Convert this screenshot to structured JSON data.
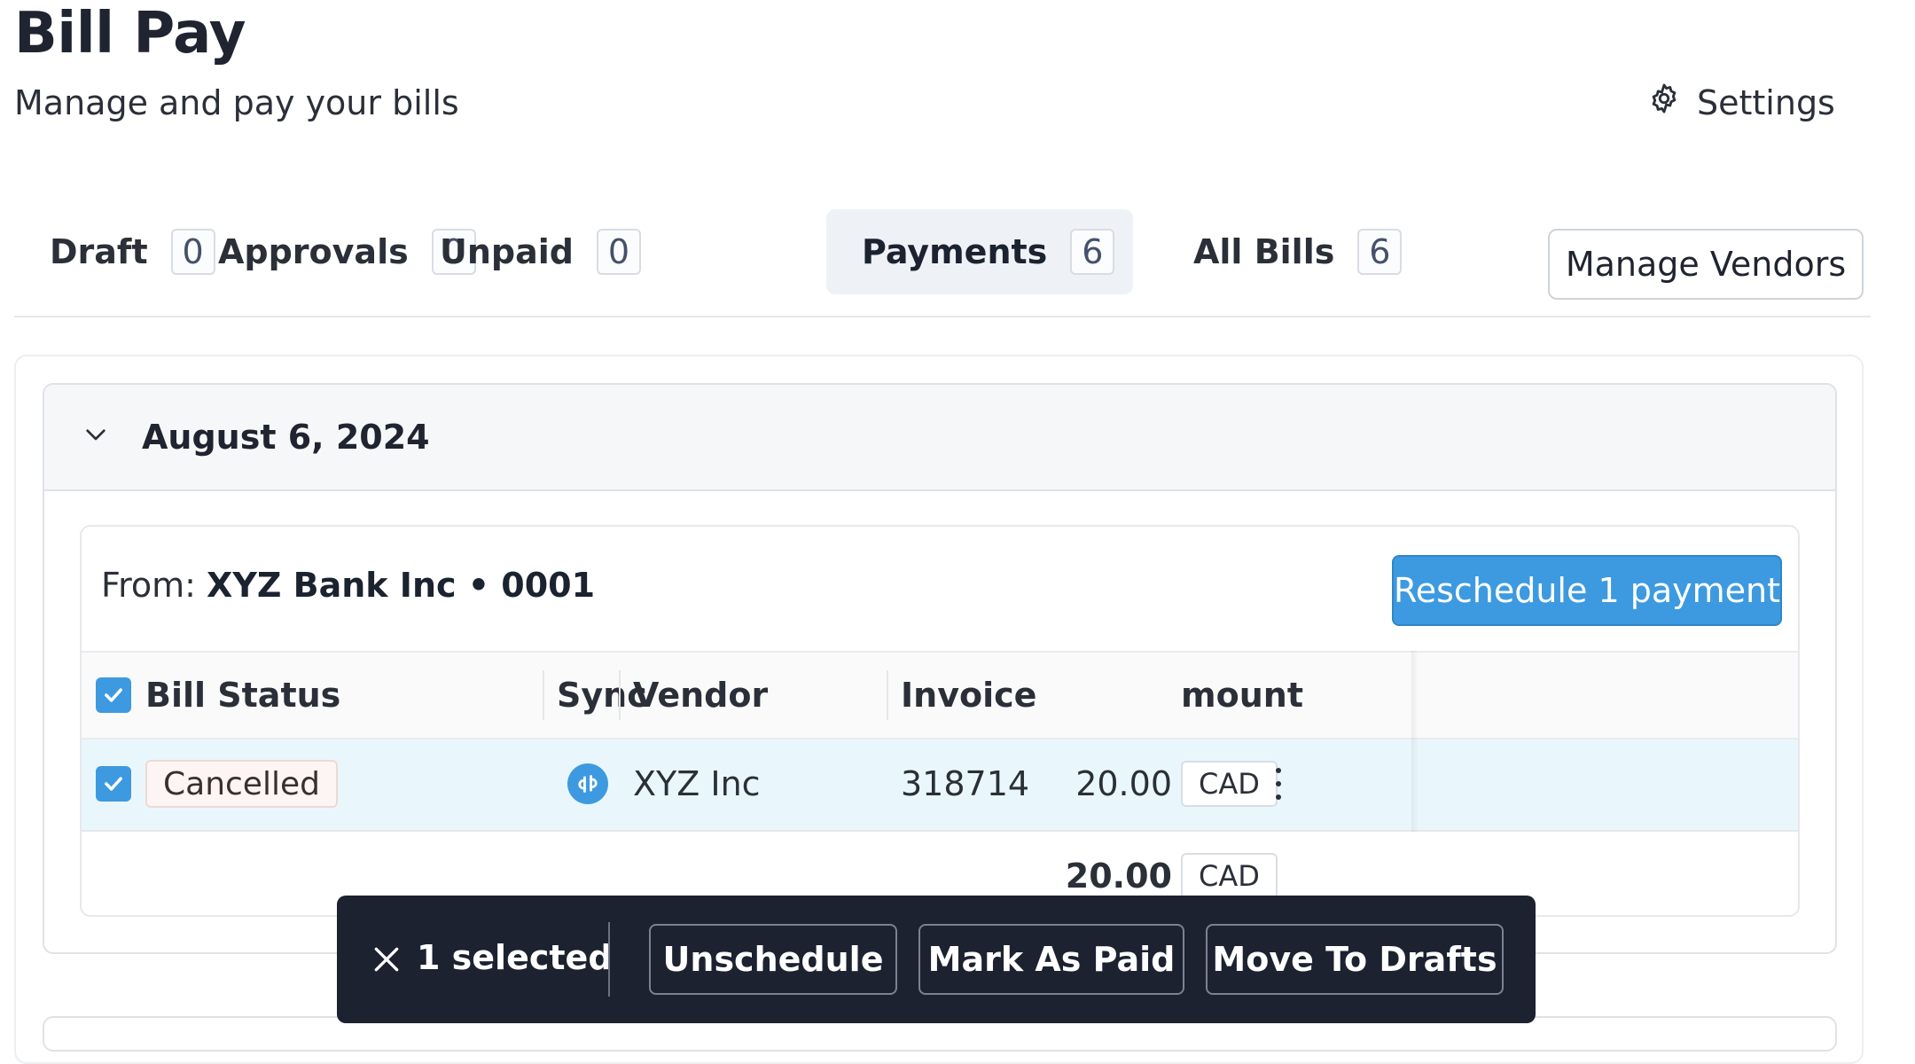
{
  "header": {
    "title": "Bill Pay",
    "subtitle": "Manage and pay your bills",
    "settings_label": "Settings",
    "settings_icon": "gear-icon"
  },
  "tabs": [
    {
      "label": "Draft",
      "count": "0",
      "active": false
    },
    {
      "label": "Approvals",
      "count": "0",
      "active": false
    },
    {
      "label": "Unpaid",
      "count": "0",
      "active": false
    },
    {
      "label": "Payments",
      "count": "6",
      "active": true
    },
    {
      "label": "All Bills",
      "count": "6",
      "active": false
    }
  ],
  "manage_vendors_label": "Manage Vendors",
  "date_group": {
    "date": "August 6, 2024",
    "expanded": true
  },
  "account": {
    "from_label": "From:",
    "account_name": "XYZ Bank Inc • 0001",
    "reschedule_label": "Reschedule 1 payment"
  },
  "table": {
    "columns": [
      "Bill Status",
      "Sync",
      "Vendor",
      "Invoice Number",
      "Amount"
    ],
    "rows": [
      {
        "checked": true,
        "status": "Cancelled",
        "sync_icon": "quickbooks-icon",
        "vendor": "XYZ Inc",
        "invoice": "318714",
        "amount": "20.00",
        "currency": "CAD"
      }
    ],
    "total": {
      "amount": "20.00",
      "currency": "CAD"
    }
  },
  "action_bar": {
    "selected_text": "1 selected",
    "buttons": [
      "Unschedule",
      "Mark As Paid",
      "Move To Drafts"
    ]
  },
  "colors": {
    "accent": "#3d9ae0",
    "action_bar_bg": "#1c2230",
    "selected_row_bg": "#e9f7fc"
  }
}
